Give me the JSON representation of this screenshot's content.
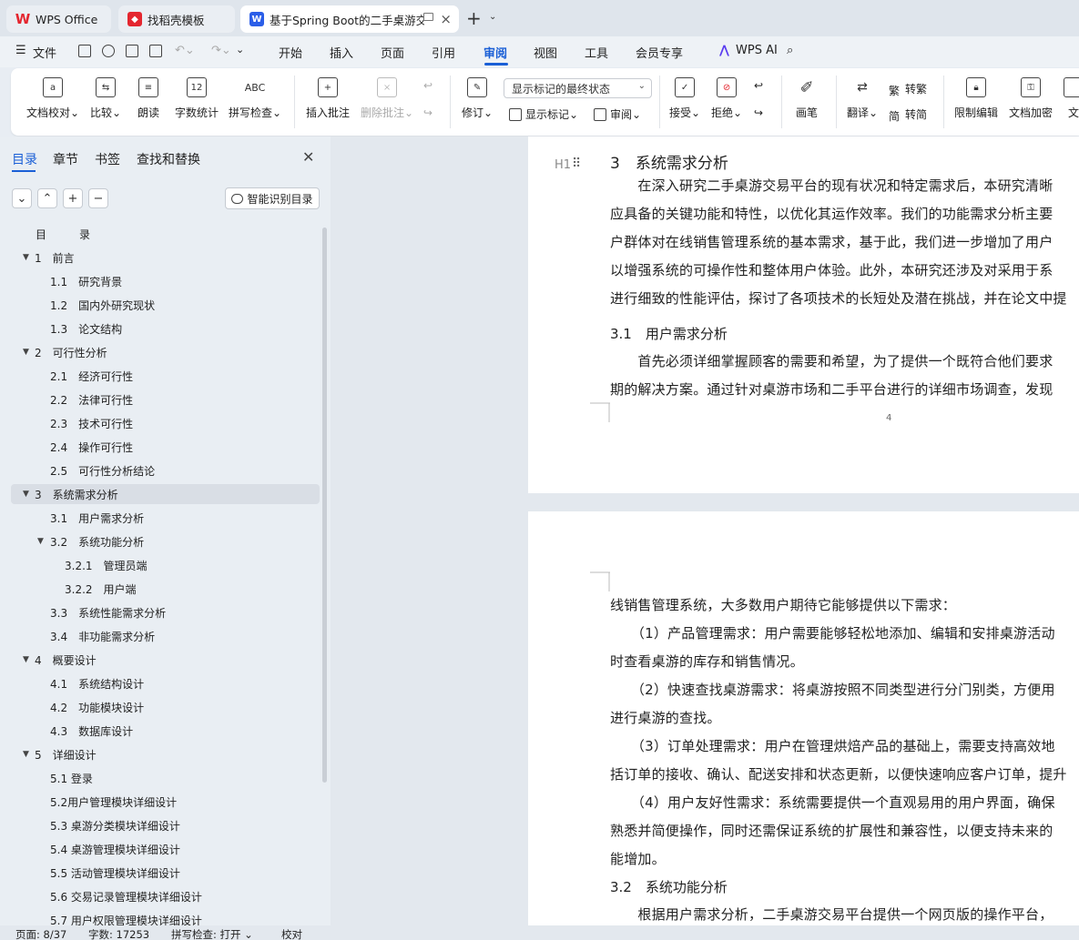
{
  "tabs": [
    {
      "label": "WPS Office",
      "icon": "wps-logo-icon"
    },
    {
      "label": "找稻壳模板",
      "icon": "docer-icon"
    },
    {
      "label": "基于Spring Boot的二手桌游交",
      "icon": "word-doc-icon"
    }
  ],
  "menu": {
    "file": "文件",
    "items": [
      "开始",
      "插入",
      "页面",
      "引用",
      "审阅",
      "视图",
      "工具",
      "会员专享"
    ],
    "active": "审阅",
    "ai": "WPS AI"
  },
  "ribbon": {
    "proofread": "文档校对",
    "compare": "比较",
    "read_aloud": "朗读",
    "word_count": "字数统计",
    "spellcheck": "拼写检查",
    "insert_comment": "插入批注",
    "delete_comment": "删除批注",
    "track": "修订",
    "markup_state": "显示标记的最终状态",
    "show_markup": "显示标记",
    "review": "审阅",
    "accept": "接受",
    "reject": "拒绝",
    "pen": "画笔",
    "translate": "翻译",
    "to_traditional": "转繁",
    "to_simplified": "转简",
    "restrict": "限制编辑",
    "encrypt": "文档加密",
    "more": "文"
  },
  "nav": {
    "tabs": [
      "目录",
      "章节",
      "书签",
      "查找和替换"
    ],
    "smart_btn": "智能识别目录",
    "toc": [
      {
        "text": "目　　　录",
        "level": 0
      },
      {
        "text": "1　前言",
        "level": 1,
        "arrow": true
      },
      {
        "text": "1.1　研究背景",
        "level": 2
      },
      {
        "text": "1.2　国内外研究现状",
        "level": 2
      },
      {
        "text": "1.3　论文结构",
        "level": 2
      },
      {
        "text": "2　可行性分析",
        "level": 1,
        "arrow": true
      },
      {
        "text": "2.1　经济可行性",
        "level": 2
      },
      {
        "text": "2.2　法律可行性",
        "level": 2
      },
      {
        "text": "2.3　技术可行性",
        "level": 2
      },
      {
        "text": "2.4　操作可行性",
        "level": 2
      },
      {
        "text": "2.5　可行性分析结论",
        "level": 2
      },
      {
        "text": "3　系统需求分析",
        "level": 1,
        "arrow": true,
        "selected": true
      },
      {
        "text": "3.1　用户需求分析",
        "level": 2
      },
      {
        "text": "3.2　系统功能分析",
        "level": 2,
        "arrow": true
      },
      {
        "text": "3.2.1　管理员端",
        "level": 3
      },
      {
        "text": "3.2.2　用户端",
        "level": 3
      },
      {
        "text": "3.3　系统性能需求分析",
        "level": 2
      },
      {
        "text": "3.4　非功能需求分析",
        "level": 2
      },
      {
        "text": "4　概要设计",
        "level": 1,
        "arrow": true
      },
      {
        "text": "4.1　系统结构设计",
        "level": 2
      },
      {
        "text": "4.2　功能模块设计",
        "level": 2
      },
      {
        "text": "4.3　数据库设计",
        "level": 2
      },
      {
        "text": "5　详细设计",
        "level": 1,
        "arrow": true
      },
      {
        "text": "5.1 登录",
        "level": 2
      },
      {
        "text": "5.2用户管理模块详细设计",
        "level": 2
      },
      {
        "text": "5.3 桌游分类模块详细设计",
        "level": 2
      },
      {
        "text": "5.4 桌游管理模块详细设计",
        "level": 2
      },
      {
        "text": "5.5 活动管理模块详细设计",
        "level": 2
      },
      {
        "text": "5.6 交易记录管理模块详细设计",
        "level": 2
      },
      {
        "text": "5.7 用户权限管理模块详细设计",
        "level": 2
      }
    ]
  },
  "doc": {
    "page1": {
      "heading_marker": "H1",
      "heading": "3　系统需求分析",
      "lines": [
        "　　在深入研究二手桌游交易平台的现有状况和特定需求后，本研究清晰",
        "应具备的关键功能和特性，以优化其运作效率。我们的功能需求分析主要",
        "户群体对在线销售管理系统的基本需求，基于此，我们进一步增加了用户",
        "以增强系统的可操作性和整体用户体验。此外，本研究还涉及对采用于系",
        "进行细致的性能评估，探讨了各项技术的长短处及潜在挑战，并在论文中提"
      ],
      "sub_heading": "3.1　用户需求分析",
      "lines2": [
        "　　首先必须详细掌握顾客的需要和希望，为了提供一个既符合他们要求",
        "期的解决方案。通过针对桌游市场和二手平台进行的详细市场调查，发现"
      ],
      "page_number": "4"
    },
    "page2": {
      "lines": [
        "线销售管理系统，大多数用户期待它能够提供以下需求：",
        "　　（1）产品管理需求：用户需要能够轻松地添加、编辑和安排桌游活动",
        "时查看桌游的库存和销售情况。",
        "　　（2）快速查找桌游需求：将桌游按照不同类型进行分门别类，方便用",
        "进行桌游的查找。",
        "　　（3）订单处理需求：用户在管理烘焙产品的基础上，需要支持高效地",
        "括订单的接收、确认、配送安排和状态更新，以便快速响应客户订单，提升",
        "　　（4）用户友好性需求：系统需要提供一个直观易用的用户界面，确保",
        "熟悉并简便操作，同时还需保证系统的扩展性和兼容性，以便支持未来的",
        "能增加。"
      ],
      "sub_heading": "3.2　系统功能分析",
      "last_line": "　　根据用户需求分析，二手桌游交易平台提供一个网页版的操作平台，"
    }
  },
  "status": {
    "page": "页面: 8/37",
    "words": "字数: 17253",
    "spell": "拼写检查: 打开",
    "proof": "校对"
  }
}
